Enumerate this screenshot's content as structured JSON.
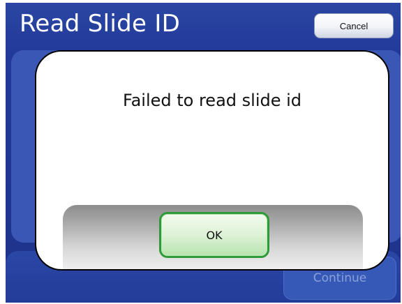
{
  "header": {
    "title": "Read Slide ID",
    "cancel_label": "Cancel"
  },
  "footer": {
    "continue_label": "Continue"
  },
  "dialog": {
    "message": "Failed to read slide id",
    "ok_label": "OK"
  },
  "colors": {
    "background_blue": "#22399a",
    "ok_border_green": "#2e9a3a"
  }
}
